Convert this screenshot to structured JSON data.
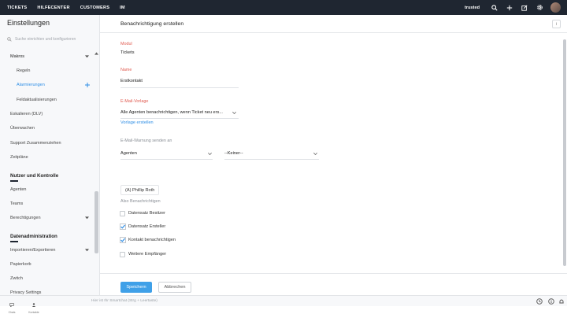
{
  "topnav": {
    "items": [
      "TICKETS",
      "HILFECENTER",
      "CUSTOMERS",
      "IM"
    ],
    "username": "trusted",
    "icons": [
      "search-icon",
      "plus-icon",
      "compose-icon",
      "gear-icon",
      "avatar"
    ]
  },
  "sidebar": {
    "title": "Einstellungen",
    "search_placeholder": "Suche einrichten und konfigurieren",
    "items": {
      "makros": "Makros",
      "regeln": "Regeln",
      "alarmierungen": "Alarmierungen",
      "feldaktualisierungen": "Feldaktualisierungen",
      "eskalieren": "Eskalieren (DLV)",
      "ueberwachen": "Überwachen",
      "support": "Support Zusammenziehen",
      "zeitplaene": "Zeitpläne",
      "section_nutzer": "Nutzer und Kontrolle",
      "agenten": "Agenten",
      "teams": "Teams",
      "berechtigungen": "Berechtigungen",
      "section_daten": "Datenadministration",
      "import": "Importieren/Exportieren",
      "papierkorb": "Papierkorb",
      "zwitsch": "Zwitch",
      "privacy": "Privacy Settings"
    }
  },
  "main": {
    "title": "Benachrichtigung erstellen",
    "info_button": "i",
    "modul_label": "Modul",
    "modul_value": "Tickets",
    "name_label": "Name",
    "name_value": "Erstkontakt",
    "template_label": "E-Mail-Vorlage",
    "template_value": "Alle Agenten benachrichtigen, wenn Ticket neu ers...",
    "template_link": "Vorlage erstellen",
    "send_label": "E-Mail-Warnung senden an",
    "send_select1": "Agenten",
    "send_select2": "--Keiner--",
    "chip": "(A) Phillip Roth",
    "notify_label": "Also Benachrichtigen",
    "checkboxes": [
      {
        "label": "Datensatz Besitzer",
        "checked": false
      },
      {
        "label": "Datensatz Ersteller",
        "checked": true
      },
      {
        "label": "Kontakt benachrichtigen",
        "checked": true
      },
      {
        "label": "Weitere Empfänger",
        "checked": false
      }
    ],
    "save": "Speichern",
    "cancel": "Abbrechen"
  },
  "bottombar": {
    "tab1": "Chats",
    "tab2": "Kontakte",
    "hint": "Hier ist Ihr Smartchat (Strg + Leertaste)"
  },
  "colors": {
    "topbar": "#1f2631",
    "accent": "#2e8ee6",
    "required": "#e05a4f"
  }
}
